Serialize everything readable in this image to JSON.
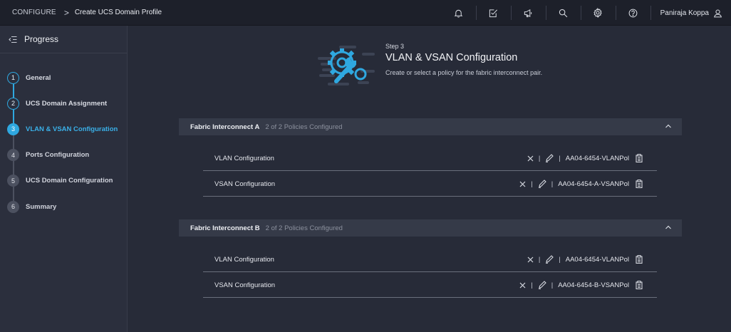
{
  "topbar": {
    "breadcrumb_root": "CONFIGURE",
    "breadcrumb_sep": ">",
    "breadcrumb_current": "Create UCS Domain Profile",
    "user_name": "Paniraja Koppa",
    "icons": [
      "bell-icon",
      "checklist-icon",
      "megaphone-icon",
      "search-icon",
      "gear-icon",
      "help-icon",
      "user-icon"
    ]
  },
  "sidebar": {
    "title": "Progress",
    "steps": [
      {
        "num": "1",
        "label": "General",
        "state": "done"
      },
      {
        "num": "2",
        "label": "UCS Domain Assignment",
        "state": "done"
      },
      {
        "num": "3",
        "label": "VLAN & VSAN Configuration",
        "state": "active"
      },
      {
        "num": "4",
        "label": "Ports Configuration",
        "state": "pending"
      },
      {
        "num": "5",
        "label": "UCS Domain Configuration",
        "state": "pending"
      },
      {
        "num": "6",
        "label": "Summary",
        "state": "pending"
      }
    ]
  },
  "main": {
    "step_no": "Step 3",
    "title": "VLAN & VSAN Configuration",
    "description": "Create or select a policy for the fabric interconnect pair.",
    "sections": [
      {
        "title": "Fabric Interconnect A",
        "status": "2 of 2 Policies Configured",
        "rows": [
          {
            "label": "VLAN Configuration",
            "policy": "AA04-6454-VLANPol"
          },
          {
            "label": "VSAN Configuration",
            "policy": "AA04-6454-A-VSANPol"
          }
        ]
      },
      {
        "title": "Fabric Interconnect B",
        "status": "2 of 2 Policies Configured",
        "rows": [
          {
            "label": "VLAN Configuration",
            "policy": "AA04-6454-VLANPol"
          },
          {
            "label": "VSAN Configuration",
            "policy": "AA04-6454-B-VSANPol"
          }
        ]
      }
    ],
    "separator": "|"
  },
  "colors": {
    "accent": "#2fa8e0",
    "background": "#272b38",
    "topbar": "#1d202a",
    "sidebar": "#2b2f3d"
  }
}
